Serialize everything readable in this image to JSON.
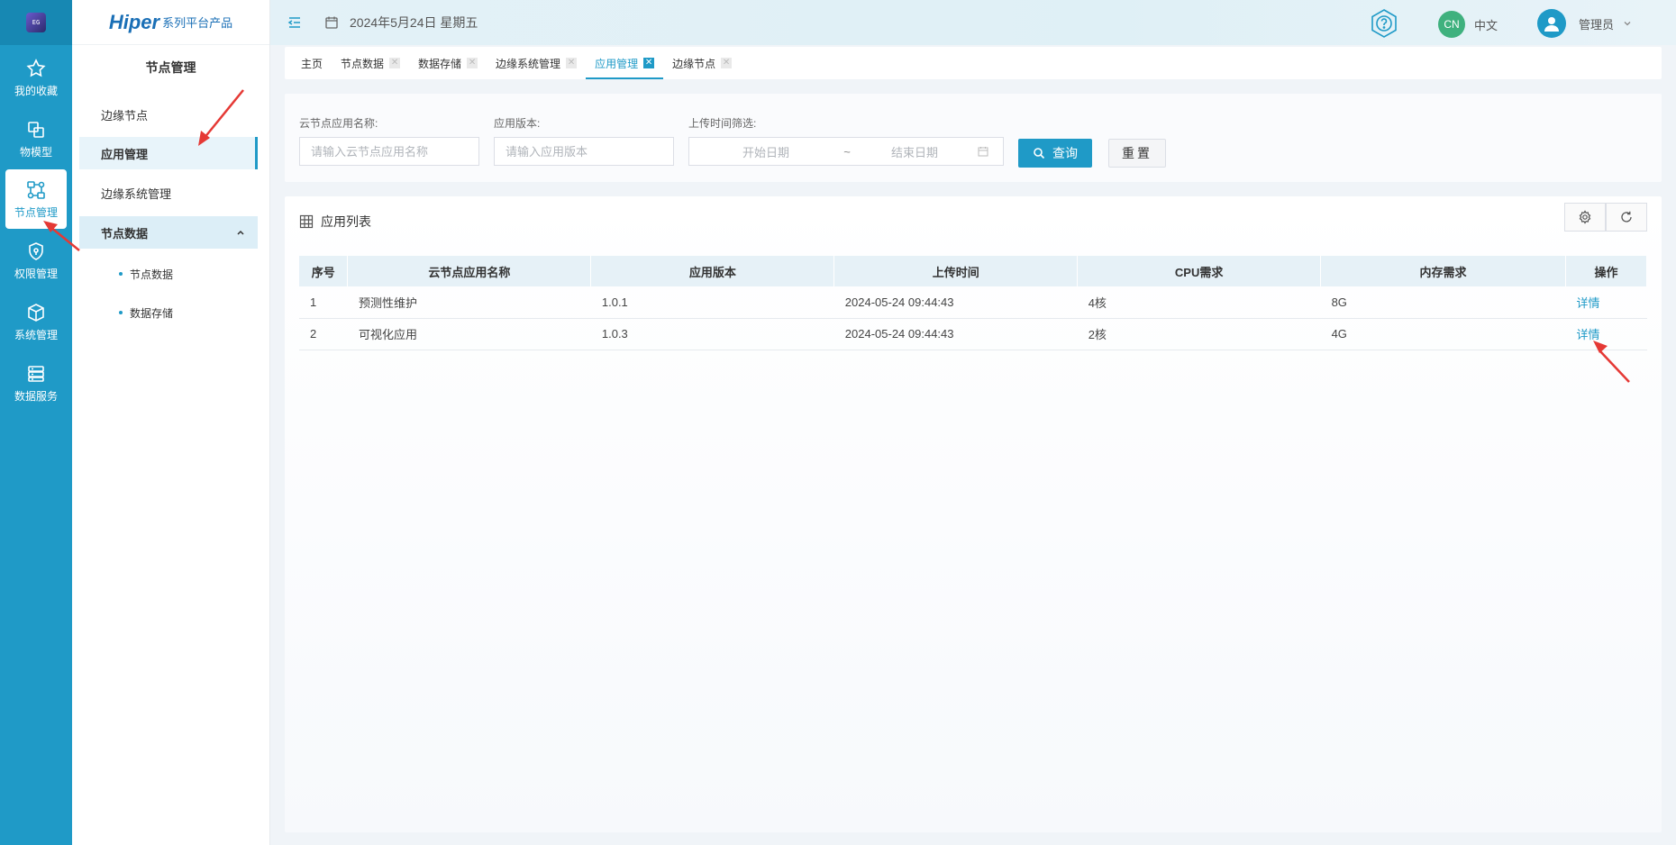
{
  "rail": {
    "logo_text": "EG",
    "items": [
      {
        "label": "我的收藏",
        "icon": "star-icon"
      },
      {
        "label": "物模型",
        "icon": "model-icon"
      },
      {
        "label": "节点管理",
        "icon": "node-icon"
      },
      {
        "label": "权限管理",
        "icon": "shield-icon"
      },
      {
        "label": "系统管理",
        "icon": "cube-icon"
      },
      {
        "label": "数据服务",
        "icon": "server-icon"
      }
    ],
    "active_index": 2
  },
  "brand": {
    "name": "Hiper",
    "suffix": "系列平台产品"
  },
  "sidebar": {
    "title": "节点管理",
    "items": [
      {
        "label": "边缘节点"
      },
      {
        "label": "应用管理"
      },
      {
        "label": "边缘系统管理"
      },
      {
        "label": "节点数据"
      }
    ],
    "sub_items": [
      {
        "label": "节点数据"
      },
      {
        "label": "数据存储"
      }
    ]
  },
  "header": {
    "date": "2024年5月24日 星期五",
    "lang_badge": "CN",
    "lang_label": "中文",
    "user": "管理员"
  },
  "tabs": [
    {
      "label": "主页",
      "closable": false
    },
    {
      "label": "节点数据",
      "closable": true
    },
    {
      "label": "数据存储",
      "closable": true
    },
    {
      "label": "边缘系统管理",
      "closable": true
    },
    {
      "label": "应用管理",
      "closable": true,
      "active": true
    },
    {
      "label": "边缘节点",
      "closable": true
    }
  ],
  "search": {
    "name_label": "云节点应用名称:",
    "name_placeholder": "请输入云节点应用名称",
    "version_label": "应用版本:",
    "version_placeholder": "请输入应用版本",
    "time_label": "上传时间筛选:",
    "start_placeholder": "开始日期",
    "range_sep": "~",
    "end_placeholder": "结束日期",
    "query_button": "查询",
    "reset_button": "重置"
  },
  "list": {
    "title": "应用列表",
    "columns": [
      "序号",
      "云节点应用名称",
      "应用版本",
      "上传时间",
      "CPU需求",
      "内存需求",
      "操作"
    ],
    "rows": [
      {
        "idx": "1",
        "name": "预测性维护",
        "version": "1.0.1",
        "time": "2024-05-24 09:44:43",
        "cpu": "4核",
        "mem": "8G",
        "action": "详情"
      },
      {
        "idx": "2",
        "name": "可视化应用",
        "version": "1.0.3",
        "time": "2024-05-24 09:44:43",
        "cpu": "2核",
        "mem": "4G",
        "action": "详情"
      }
    ]
  },
  "colors": {
    "accent": "#1f9ac7",
    "rail": "#1f9ac7",
    "annotation": "#e53935"
  }
}
